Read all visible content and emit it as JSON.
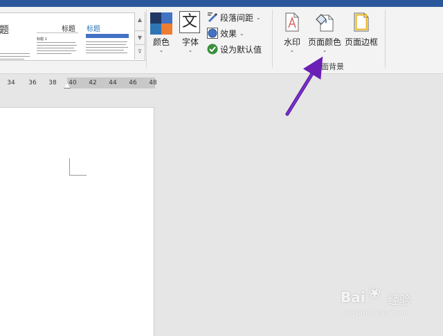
{
  "ribbon": {
    "style_gallery": {
      "partial_title": "题",
      "style2": {
        "title": "标题",
        "heading": "标题 1"
      },
      "style3": {
        "title": "标题"
      }
    },
    "colors": {
      "label": "颜色"
    },
    "fonts": {
      "label": "字体",
      "glyph": "文"
    },
    "paragraph_spacing": {
      "label": "段落间距"
    },
    "effects": {
      "label": "效果"
    },
    "set_default": {
      "label": "设为默认值"
    },
    "watermark": {
      "label": "水印"
    },
    "page_color": {
      "label": "页面颜色"
    },
    "page_borders": {
      "label": "页面边框"
    },
    "group_label": "面背景"
  },
  "ruler": {
    "ticks": [
      "34",
      "36",
      "38",
      "40",
      "42",
      "44",
      "46",
      "48"
    ]
  },
  "watermark_overlay": {
    "brand_a": "Bai",
    "brand_b": "经验",
    "url": "jingyan.baidu.com"
  },
  "colors": {
    "titlebar": "#2b579a",
    "arrow": "#6a1fb5",
    "palette": [
      "#1f3864",
      "#4472c4",
      "#2e75b6",
      "#ed7d31"
    ]
  }
}
